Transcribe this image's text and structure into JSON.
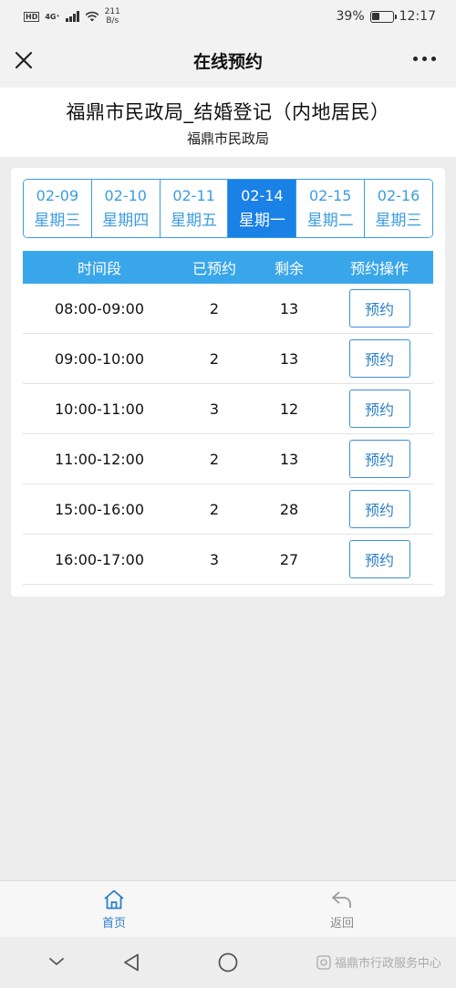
{
  "status_bar": {
    "hd": "HD",
    "network": "4G⁺",
    "speed_value": "211",
    "speed_unit": "B/s",
    "battery_percent": "39%",
    "battery_level": 0.39,
    "time": "12:17"
  },
  "nav": {
    "title": "在线预约",
    "close_icon": "close-icon",
    "more_icon": "more-dots-icon"
  },
  "header": {
    "title": "福鼎市民政局_结婚登记（内地居民）",
    "subtitle": "福鼎市民政局"
  },
  "date_tabs": [
    {
      "date": "02-09",
      "weekday": "星期三",
      "active": false
    },
    {
      "date": "02-10",
      "weekday": "星期四",
      "active": false
    },
    {
      "date": "02-11",
      "weekday": "星期五",
      "active": false
    },
    {
      "date": "02-14",
      "weekday": "星期一",
      "active": true
    },
    {
      "date": "02-15",
      "weekday": "星期二",
      "active": false
    },
    {
      "date": "02-16",
      "weekday": "星期三",
      "active": false
    }
  ],
  "table": {
    "headers": {
      "time": "时间段",
      "booked": "已预约",
      "remaining": "剩余",
      "operation": "预约操作"
    },
    "rows": [
      {
        "time": "08:00-09:00",
        "booked": "2",
        "remaining": "13",
        "action": "预约"
      },
      {
        "time": "09:00-10:00",
        "booked": "2",
        "remaining": "13",
        "action": "预约"
      },
      {
        "time": "10:00-11:00",
        "booked": "3",
        "remaining": "12",
        "action": "预约"
      },
      {
        "time": "11:00-12:00",
        "booked": "2",
        "remaining": "13",
        "action": "预约"
      },
      {
        "time": "15:00-16:00",
        "booked": "2",
        "remaining": "28",
        "action": "预约"
      },
      {
        "time": "16:00-17:00",
        "booked": "3",
        "remaining": "27",
        "action": "预约"
      }
    ]
  },
  "tab_bar": {
    "home": "首页",
    "back": "返回"
  },
  "watermark": "福鼎市行政服务中心",
  "colors": {
    "accent": "#1a81e6",
    "header_blue": "#3aa6ea",
    "tab_border": "#3b9de2"
  }
}
